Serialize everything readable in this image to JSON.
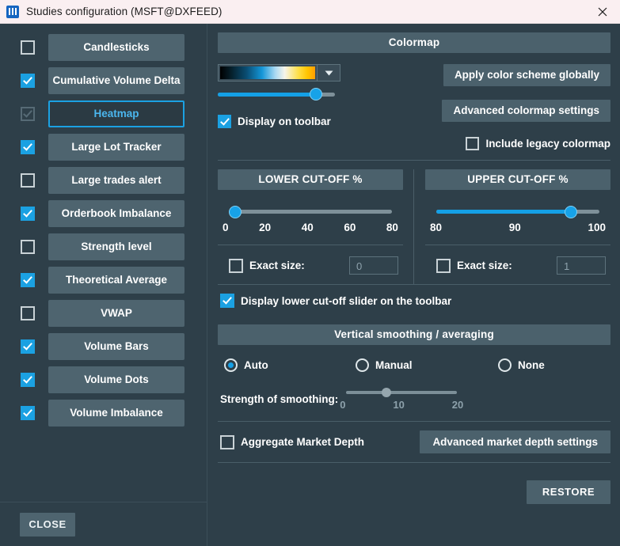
{
  "window": {
    "title": "Studies configuration (MSFT@DXFEED)",
    "app_icon": "bars-icon",
    "close_icon": "close-icon"
  },
  "sidebar": {
    "items": [
      {
        "label": "Candlesticks",
        "checked": false,
        "selected": false,
        "disabled": false
      },
      {
        "label": "Cumulative Volume Delta",
        "checked": true,
        "selected": false,
        "disabled": false
      },
      {
        "label": "Heatmap",
        "checked": true,
        "selected": true,
        "disabled": true
      },
      {
        "label": "Large Lot Tracker",
        "checked": true,
        "selected": false,
        "disabled": false
      },
      {
        "label": "Large trades alert",
        "checked": false,
        "selected": false,
        "disabled": false
      },
      {
        "label": "Orderbook Imbalance",
        "checked": true,
        "selected": false,
        "disabled": false
      },
      {
        "label": "Strength level",
        "checked": false,
        "selected": false,
        "disabled": false
      },
      {
        "label": "Theoretical Average",
        "checked": true,
        "selected": false,
        "disabled": false
      },
      {
        "label": "VWAP",
        "checked": false,
        "selected": false,
        "disabled": false
      },
      {
        "label": "Volume Bars",
        "checked": true,
        "selected": false,
        "disabled": false
      },
      {
        "label": "Volume Dots",
        "checked": true,
        "selected": false,
        "disabled": false
      },
      {
        "label": "Volume Imbalance",
        "checked": true,
        "selected": false,
        "disabled": false
      }
    ],
    "close_label": "CLOSE"
  },
  "colormap": {
    "header": "Colormap",
    "swatch_dropdown_icon": "chevron-down-icon",
    "opacity_value": 88,
    "display_on_toolbar": {
      "label": "Display on toolbar",
      "checked": true
    },
    "apply_globally_label": "Apply color scheme globally",
    "advanced_settings_label": "Advanced colormap settings",
    "include_legacy": {
      "label": "Include legacy colormap",
      "checked": false
    }
  },
  "lower_cutoff": {
    "header": "LOWER CUT-OFF %",
    "value": 0,
    "min": 0,
    "max": 100,
    "ticks": [
      "0",
      "20",
      "40",
      "60",
      "80"
    ],
    "exact_size": {
      "label": "Exact size:",
      "checked": false,
      "value": "0"
    }
  },
  "upper_cutoff": {
    "header": "UPPER CUT-OFF %",
    "value": 97,
    "min": 80,
    "max": 100,
    "ticks": [
      "80",
      "90",
      "100"
    ],
    "exact_size": {
      "label": "Exact size:",
      "checked": false,
      "value": "1"
    }
  },
  "display_lower_slider": {
    "label": "Display lower cut-off slider on the toolbar",
    "checked": true
  },
  "smoothing": {
    "header": "Vertical smoothing / averaging",
    "options": [
      {
        "label": "Auto",
        "selected": true
      },
      {
        "label": "Manual",
        "selected": false
      },
      {
        "label": "None",
        "selected": false
      }
    ],
    "strength_label": "Strength of smoothing:",
    "strength_value": 7,
    "strength_min": 0,
    "strength_max": 20,
    "strength_ticks": [
      "0",
      "10",
      "20"
    ]
  },
  "market_depth": {
    "aggregate": {
      "label": "Aggregate Market Depth",
      "checked": false
    },
    "advanced_label": "Advanced market depth settings"
  },
  "footer": {
    "restore_label": "RESTORE"
  },
  "colors": {
    "accent": "#15a0e6",
    "panel_bg": "#2e3f49",
    "header_bg": "#4b616c",
    "button_bg": "#4e646f",
    "selected_text": "#4bb6ee"
  }
}
